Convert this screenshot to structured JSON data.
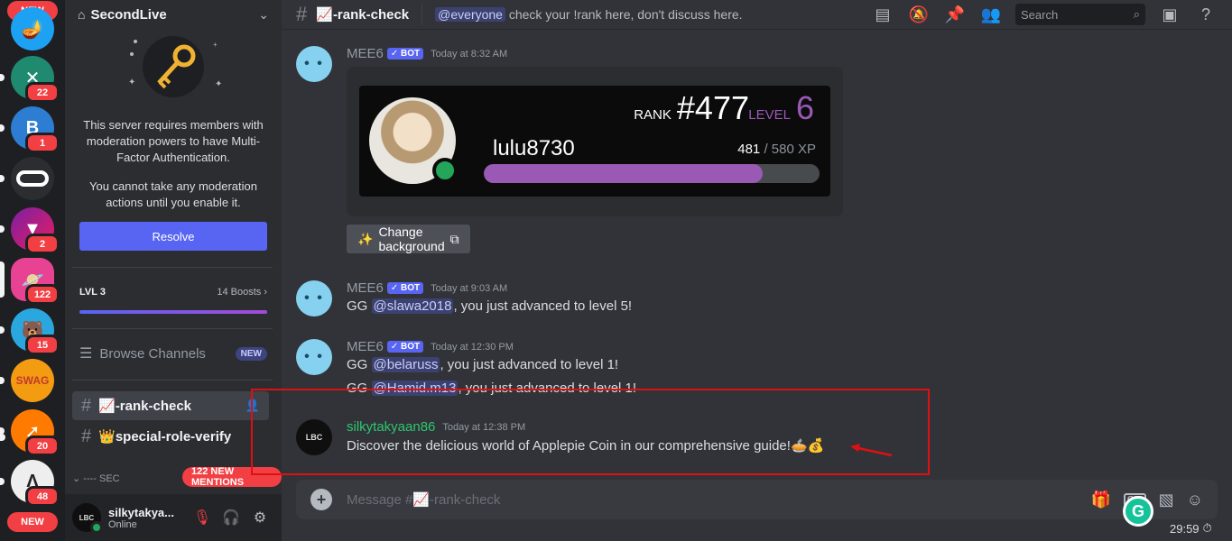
{
  "rail": {
    "top_badge": "NEW",
    "bottom_badge": "NEW",
    "servers": [
      {
        "name": "lamp-server",
        "color": "#1da1f2",
        "badge": ""
      },
      {
        "name": "v-server",
        "color": "#1f8a70",
        "badge": "22"
      },
      {
        "name": "b-server",
        "color": "#2d7dd2",
        "badge": "1"
      },
      {
        "name": "pill-server",
        "color": "#2b2d31",
        "badge": ""
      },
      {
        "name": "v-triangle-server",
        "color": "#c2185b",
        "badge": "2"
      },
      {
        "name": "planet-server",
        "color": "#e84393",
        "badge": "122"
      },
      {
        "name": "bear-server",
        "color": "#ffc107",
        "badge": "15"
      },
      {
        "name": "swag-server",
        "color": "#f39c12",
        "badge": ""
      },
      {
        "name": "arrow-server",
        "color": "#ff7a00",
        "badge": "20"
      },
      {
        "name": "a-server",
        "color": "#eeeeee",
        "badge": "48"
      }
    ]
  },
  "sidebar": {
    "server_name": "SecondLive",
    "mfa_text_1": "This server requires members with moderation powers to have Multi-Factor Authentication.",
    "mfa_text_2": "You cannot take any moderation actions until you enable it.",
    "resolve_label": "Resolve",
    "level": "LVL 3",
    "boosts": "14 Boosts",
    "browse_label": "Browse Channels",
    "browse_badge": "NEW",
    "channels": [
      {
        "emoji": "📈",
        "name": "-rank-check"
      },
      {
        "emoji": "👑",
        "name": "special-role-verify"
      }
    ],
    "section_label": "---- SEC",
    "mentions_label": "122 NEW MENTIONS",
    "user": {
      "name": "silkytakya...",
      "status": "Online",
      "avatar_text": "LBC"
    }
  },
  "topbar": {
    "channel_emoji": "📈",
    "channel_name": "-rank-check",
    "mention": "@everyone",
    "topic": " check your !rank here, don't discuss here.",
    "search_placeholder": "Search"
  },
  "messages": {
    "m1": {
      "author": "MEE6",
      "bot": "BOT",
      "time": "Today at 8:32 AM"
    },
    "rank_card": {
      "rank_label": "RANK",
      "rank": "#477",
      "level_label": "LEVEL",
      "level": "6",
      "username": "lulu8730",
      "xp_current": "481",
      "xp_max": " / 580 XP",
      "progress": 0.83
    },
    "change_bg": {
      "icon": "✨",
      "label": "Change background"
    },
    "m2": {
      "author": "MEE6",
      "bot": "BOT",
      "time": "Today at 9:03 AM",
      "pre": "GG ",
      "mention": "@slawa2018",
      "post": ", you just advanced to level 5!"
    },
    "m3": {
      "author": "MEE6",
      "bot": "BOT",
      "time": "Today at 12:30 PM",
      "pre": "GG ",
      "mention": "@belaruss",
      "post": ", you just advanced to level 1!",
      "pre2": "GG ",
      "mention2": "@Hamid.m13",
      "post2": ", you just advanced to level 1!"
    },
    "m4": {
      "author": "silkytakyaan86",
      "time": "Today at 12:38 PM",
      "text": "Discover the delicious world of Applepie Coin in our comprehensive guide!🥧💰",
      "avatar_text": "LBC"
    }
  },
  "composer": {
    "placeholder": "Message #📈-rank-check",
    "gif": "GIF"
  },
  "timer": "29:59",
  "colors": {
    "accent": "#5865f2",
    "level_purple": "#9b59b6",
    "online": "#23a55a",
    "alert": "#f23f43",
    "highlight": "#e01010"
  }
}
